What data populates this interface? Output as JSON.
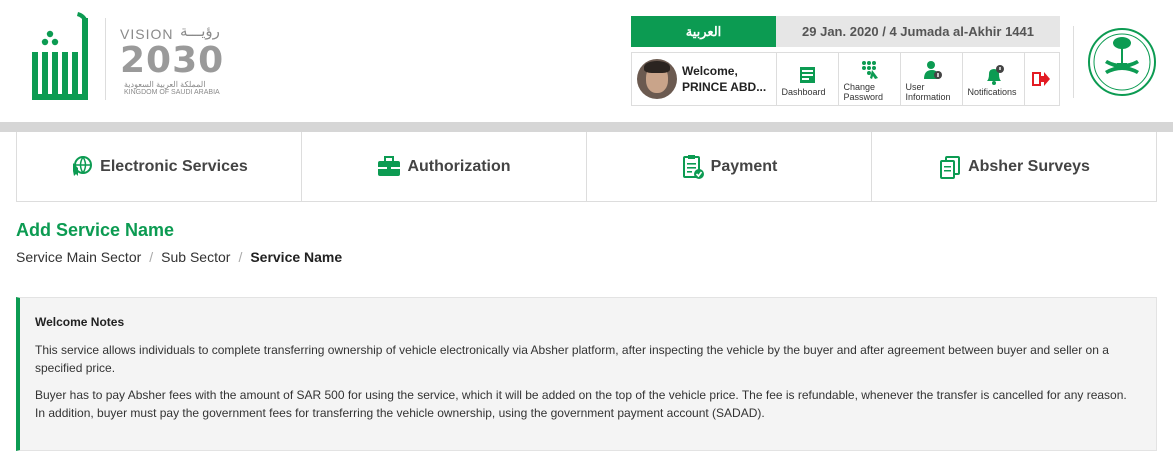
{
  "header": {
    "vision": {
      "label": "VISION",
      "arabic": "رؤيـــة",
      "year": "2030",
      "sub_arabic": "المملكة العربية السعودية",
      "sub_english": "KINGDOM OF SAUDI ARABIA"
    },
    "language_button": "العربية",
    "date": "29 Jan. 2020 / 4 Jumada al-Akhir 1441",
    "user": {
      "welcome": "Welcome,",
      "name": "PRINCE ABD..."
    },
    "tools": [
      {
        "label": "Dashboard",
        "icon": "dashboard-icon"
      },
      {
        "label": "Change Password",
        "icon": "keypad-icon"
      },
      {
        "label": "User Information",
        "icon": "user-info-icon"
      },
      {
        "label": "Notifications",
        "icon": "bell-icon"
      },
      {
        "label": "",
        "icon": "logout-icon"
      }
    ],
    "colors": {
      "brand": "#0c9b52",
      "logout": "#e31b23"
    }
  },
  "nav": {
    "items": [
      {
        "label": "Electronic Services",
        "icon": "electronic-services-icon"
      },
      {
        "label": "Authorization",
        "icon": "briefcase-icon"
      },
      {
        "label": "Payment",
        "icon": "payment-clipboard-icon"
      },
      {
        "label": "Absher Surveys",
        "icon": "surveys-icon"
      }
    ]
  },
  "page": {
    "title": "Add Service Name",
    "breadcrumb": [
      "Service Main Sector",
      "Sub Sector",
      "Service Name"
    ]
  },
  "notes": {
    "title": "Welcome Notes",
    "paragraphs": [
      "This service allows individuals to complete transferring ownership of vehicle electronically via Absher platform, after inspecting the vehicle by the buyer and after agreement between buyer and seller on a specified price.",
      "Buyer has to pay Absher fees with the amount of SAR 500 for using the service, which it will be added on the top of the vehicle price. The fee is refundable, whenever the transfer is cancelled for any reason. In addition, buyer must pay the government fees for transferring the vehicle ownership, using the government payment account (SADAD)."
    ]
  }
}
